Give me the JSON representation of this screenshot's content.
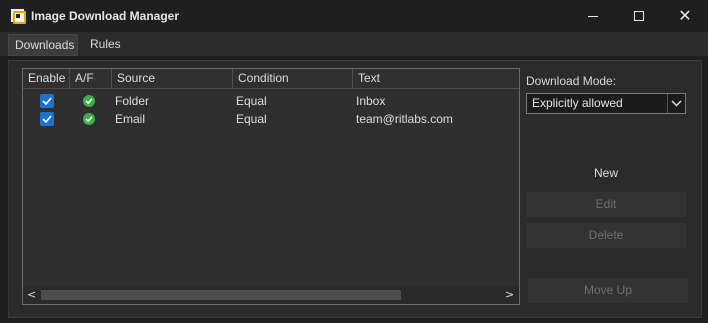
{
  "window": {
    "title": "Image Download Manager",
    "minimize_icon": "minimize-icon",
    "maximize_icon": "maximize-icon",
    "close_glyph": "✕"
  },
  "tabs": [
    {
      "label": "Downloads",
      "selected": false
    },
    {
      "label": "Rules",
      "selected": true
    }
  ],
  "grid": {
    "columns": [
      "Enable",
      "A/F",
      "Source",
      "Condition",
      "Text"
    ],
    "rows": [
      {
        "enabled": true,
        "af_icon": "green-check-icon",
        "source": "Folder",
        "condition": "Equal",
        "text": "Inbox"
      },
      {
        "enabled": true,
        "af_icon": "green-check-icon",
        "source": "Email",
        "condition": "Equal",
        "text": "team@ritlabs.com"
      }
    ],
    "scroll_left_glyph": "<",
    "scroll_right_glyph": ">"
  },
  "download_mode": {
    "label": "Download Mode:",
    "selected": "Explicitly allowed"
  },
  "buttons": {
    "new": "New",
    "edit": "Edit",
    "delete": "Delete",
    "move_up": "Move Up"
  },
  "colors": {
    "accent": "#1a73d0",
    "check_green": "#3cb043",
    "background": "#202020"
  }
}
